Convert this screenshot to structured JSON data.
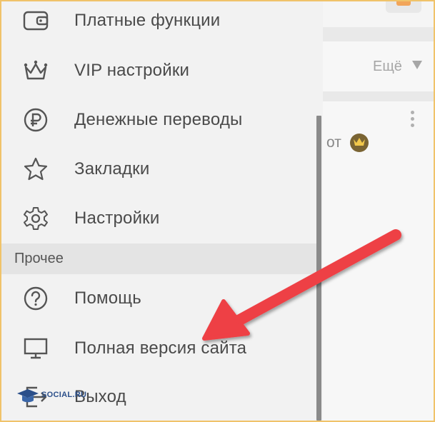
{
  "menu": {
    "items": [
      {
        "id": "paid",
        "label": "Платные функции",
        "icon": "wallet-icon"
      },
      {
        "id": "vip",
        "label": "VIP настройки",
        "icon": "crown-icon"
      },
      {
        "id": "transfers",
        "label": "Денежные переводы",
        "icon": "ruble-icon"
      },
      {
        "id": "bookmarks",
        "label": "Закладки",
        "icon": "star-icon"
      },
      {
        "id": "settings",
        "label": "Настройки",
        "icon": "gear-icon"
      }
    ],
    "section_title": "Прочее",
    "other_items": [
      {
        "id": "help",
        "label": "Помощь",
        "icon": "question-icon"
      },
      {
        "id": "fullsite",
        "label": "Полная версия сайта",
        "icon": "monitor-icon"
      },
      {
        "id": "logout",
        "label": "Выход",
        "icon": "exit-icon"
      }
    ]
  },
  "background": {
    "more_label": "Ещё",
    "feed_text": "от"
  },
  "watermark": {
    "text": "SOCIAL.RU"
  },
  "colors": {
    "frame": "#f0c36a",
    "arrow": "#ee3f45",
    "drawer_bg": "#f2f2f2",
    "section_bg": "#e4e4e4",
    "icon": "#555555"
  }
}
